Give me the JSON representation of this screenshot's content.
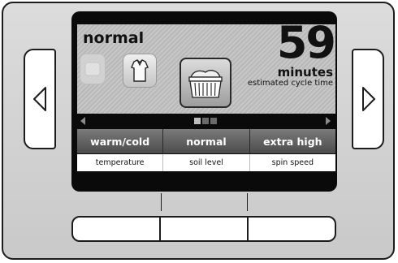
{
  "display": {
    "cycle_name": "normal",
    "minutes_value": "59",
    "minutes_unit": "minutes",
    "minutes_caption": "estimated cycle time",
    "cycle_icons": [
      "rinse-icon",
      "shirt-icon",
      "laundry-basket-icon"
    ],
    "selected_icon": "laundry-basket-icon",
    "page_indicator": {
      "pages": 3,
      "active": 1
    }
  },
  "settings": [
    {
      "value": "warm/cold",
      "label": "temperature"
    },
    {
      "value": "normal",
      "label": "soil level"
    },
    {
      "value": "extra high",
      "label": "spin speed"
    }
  ],
  "controls": {
    "left_button_icon": "triangle-left-icon",
    "right_button_icon": "triangle-right-icon",
    "bottom_button_count": 3
  },
  "colors": {
    "bezel": "#d3d3d3",
    "screen": "#0a0a0a",
    "settings_bar": "#5e5e5e",
    "outline": "#1c1c1c"
  }
}
